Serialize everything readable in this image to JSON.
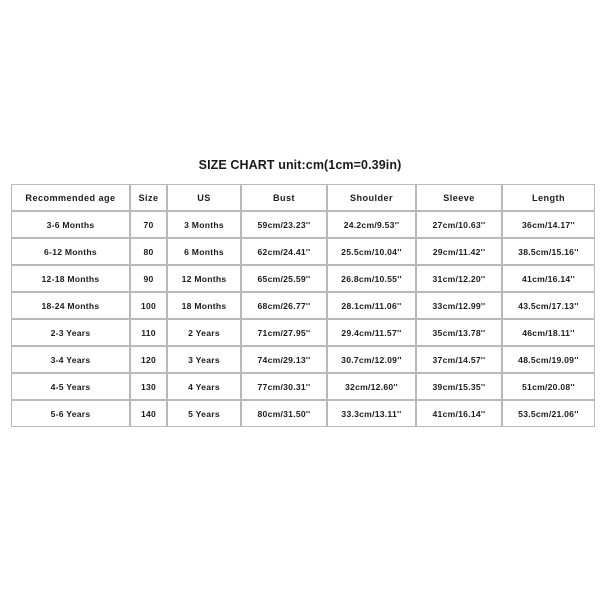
{
  "title": "SIZE CHART unit:cm(1cm=0.39in)",
  "table": {
    "headers": [
      "Recommended age",
      "Size",
      "US",
      "Bust",
      "Shoulder",
      "Sleeve",
      "Length"
    ],
    "rows": [
      [
        "3-6 Months",
        "70",
        "3 Months",
        "59cm/23.23''",
        "24.2cm/9.53''",
        "27cm/10.63''",
        "36cm/14.17''"
      ],
      [
        "6-12 Months",
        "80",
        "6 Months",
        "62cm/24.41''",
        "25.5cm/10.04''",
        "29cm/11.42''",
        "38.5cm/15.16''"
      ],
      [
        "12-18 Months",
        "90",
        "12 Months",
        "65cm/25.59''",
        "26.8cm/10.55''",
        "31cm/12.20''",
        "41cm/16.14''"
      ],
      [
        "18-24 Months",
        "100",
        "18 Months",
        "68cm/26.77''",
        "28.1cm/11.06''",
        "33cm/12.99''",
        "43.5cm/17.13''"
      ],
      [
        "2-3 Years",
        "110",
        "2 Years",
        "71cm/27.95''",
        "29.4cm/11.57''",
        "35cm/13.78''",
        "46cm/18.11''"
      ],
      [
        "3-4 Years",
        "120",
        "3 Years",
        "74cm/29.13''",
        "30.7cm/12.09''",
        "37cm/14.57''",
        "48.5cm/19.09''"
      ],
      [
        "4-5 Years",
        "130",
        "4 Years",
        "77cm/30.31''",
        "32cm/12.60''",
        "39cm/15.35''",
        "51cm/20.08''"
      ],
      [
        "5-6 Years",
        "140",
        "5 Years",
        "80cm/31.50''",
        "33.3cm/13.11''",
        "41cm/16.14''",
        "53.5cm/21.06''"
      ]
    ]
  },
  "colors": {
    "background": "#ffffff",
    "text": "#1c1c1c",
    "border": "#b9b9b9"
  }
}
